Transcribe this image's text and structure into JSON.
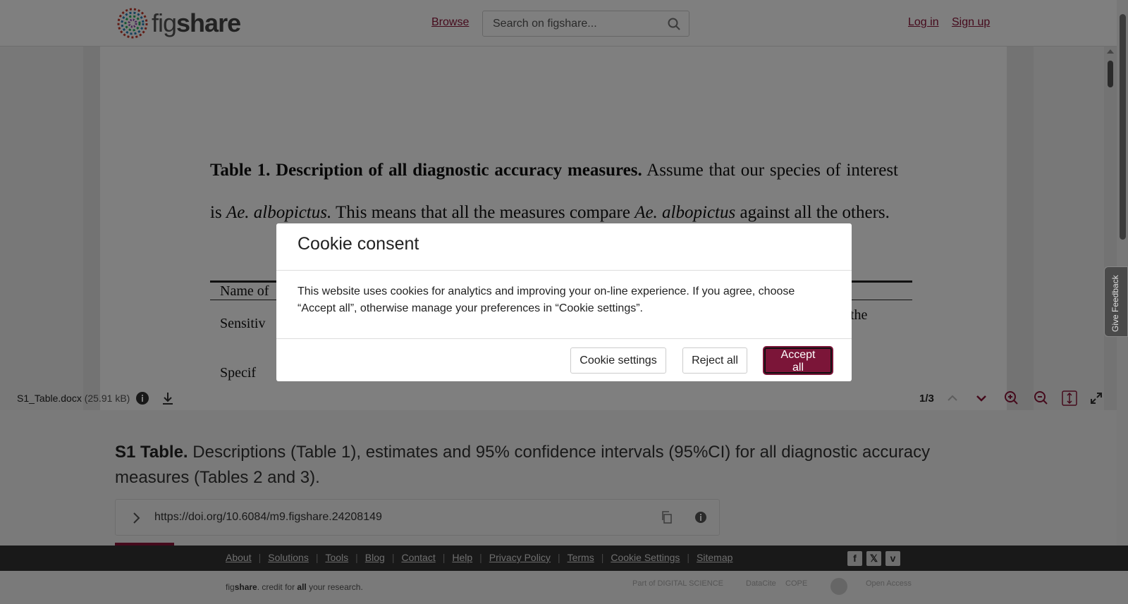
{
  "header": {
    "logo_fig": "fig",
    "logo_share": "share",
    "browse": "Browse",
    "search_placeholder": "Search on figshare...",
    "login": "Log in",
    "signup": "Sign up"
  },
  "document": {
    "para_bold": "Table 1. Description of all diagnostic accuracy measures.",
    "para_a": " Assume that our species of interest is ",
    "para_i1": "Ae. albopictus.",
    "para_b": " This means that all the measures compare ",
    "para_i2": "Ae. albopictus",
    "para_c": " against all the others.",
    "cell_header": "Name of",
    "cell_row1": "Sensitiv",
    "cell_right": "the",
    "cell_row2": "Specif"
  },
  "toolbar": {
    "file_name": "S1_Table.docx",
    "file_size": "(25.91 kB)",
    "page_indicator": "1/3"
  },
  "cookie_modal": {
    "title": "Cookie consent",
    "body": "This website uses cookies for analytics and improving your on-line experience. If you agree, choose “Accept all”, otherwise manage your preferences in “Cookie settings”.",
    "settings_button": "Cookie settings",
    "reject_button": "Reject all",
    "accept_button": "Accept all"
  },
  "item": {
    "desc_bold": "S1 Table.",
    "desc_rest": " Descriptions (Table 1), estimates and 95% confidence intervals (95%CI) for all diagnostic accuracy measures (Tables 2 and 3).",
    "doi": "https://doi.org/10.6084/m9.figshare.24208149"
  },
  "footer": {
    "links": [
      "About",
      "Solutions",
      "Tools",
      "Blog",
      "Contact",
      "Help",
      "Privacy Policy",
      "Terms",
      "Cookie Settings",
      "Sitemap"
    ],
    "tagline_fig": "fig",
    "tagline_share": "share",
    "tagline_mid": ". credit for ",
    "tagline_all": "all",
    "tagline_end": " your research.",
    "partners": [
      "Part of DIGITAL SCIENCE",
      "DataCite",
      "COPE",
      "",
      "Open Access"
    ]
  },
  "feedback": {
    "label": "Give Feedback"
  },
  "colors": {
    "brand": "#8a1538",
    "accept": "#7b1538"
  }
}
